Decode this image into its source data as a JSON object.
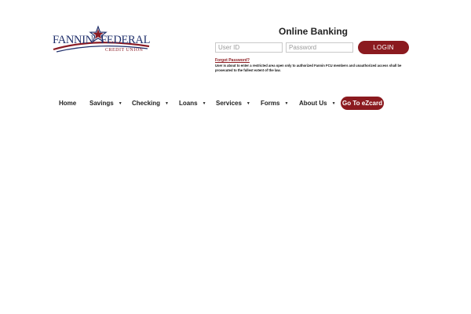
{
  "logo": {
    "word_left": "FANNIN",
    "word_right": "FEDERAL",
    "sub": "CREDIT UNION",
    "colors": {
      "navy": "#1f2f6b",
      "red": "#8a1b24"
    }
  },
  "login": {
    "title": "Online Banking",
    "user_placeholder": "User ID",
    "password_placeholder": "Password",
    "button": "LOGIN",
    "forgot": "Forgot Password?",
    "notice": "User is about to enter a restricted area open only to authorized Fannin FCU members and unauthorized access shall be prosecuted to the fullest extent of the law."
  },
  "nav": {
    "items": [
      {
        "label": "Home",
        "dropdown": false
      },
      {
        "label": "Savings",
        "dropdown": true
      },
      {
        "label": "Checking",
        "dropdown": true
      },
      {
        "label": "Loans",
        "dropdown": true
      },
      {
        "label": "Services",
        "dropdown": true
      },
      {
        "label": "Forms",
        "dropdown": true
      },
      {
        "label": "About Us",
        "dropdown": true
      }
    ],
    "cta": "Go To eZcard",
    "caret_glyph": "▼"
  },
  "colors": {
    "accent": "#8b1a1f",
    "text": "#222222",
    "background": "#ffffff"
  }
}
